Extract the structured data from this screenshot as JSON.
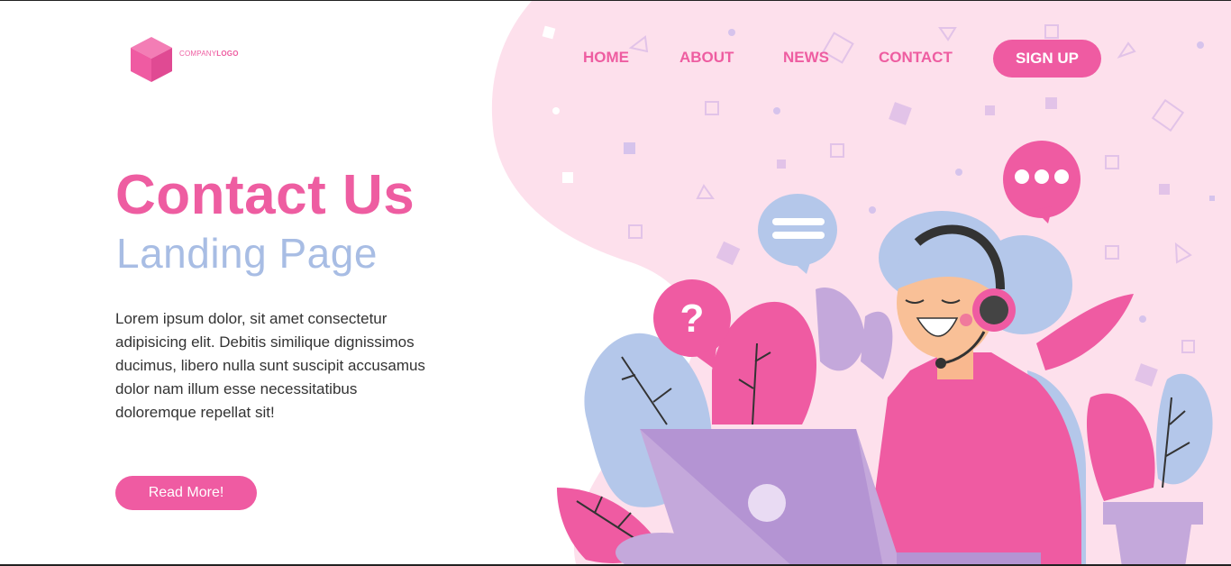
{
  "logo": {
    "prefix": "COMPANY",
    "suffix": "LOGO",
    "icon": "cube-icon"
  },
  "nav": {
    "items": [
      {
        "label": "HOME"
      },
      {
        "label": "ABOUT"
      },
      {
        "label": "NEWS"
      },
      {
        "label": "CONTACT"
      }
    ],
    "signup_label": "SIGN UP"
  },
  "hero": {
    "title": "Contact Us",
    "subtitle": "Landing Page",
    "body": "Lorem ipsum dolor, sit amet consectetur adipisicing elit. Debitis similique dignissimos ducimus, libero nulla sunt suscipit accusamus dolor nam illum esse necessitatibus doloremque repellat sit!",
    "cta_label": "Read More!"
  },
  "illustration": {
    "question_bubble_text": "?",
    "icons": [
      "question-bubble-icon",
      "message-lines-bubble-icon",
      "typing-dots-bubble-icon",
      "headset-icon",
      "laptop-icon",
      "plant-pot-icon"
    ]
  },
  "colors": {
    "accent": "#ef5ba2",
    "accent_text": "#ee5da1",
    "soft_blue": "#a8bde4",
    "blob": "#fde0ec",
    "purple": "#c4a8db"
  }
}
